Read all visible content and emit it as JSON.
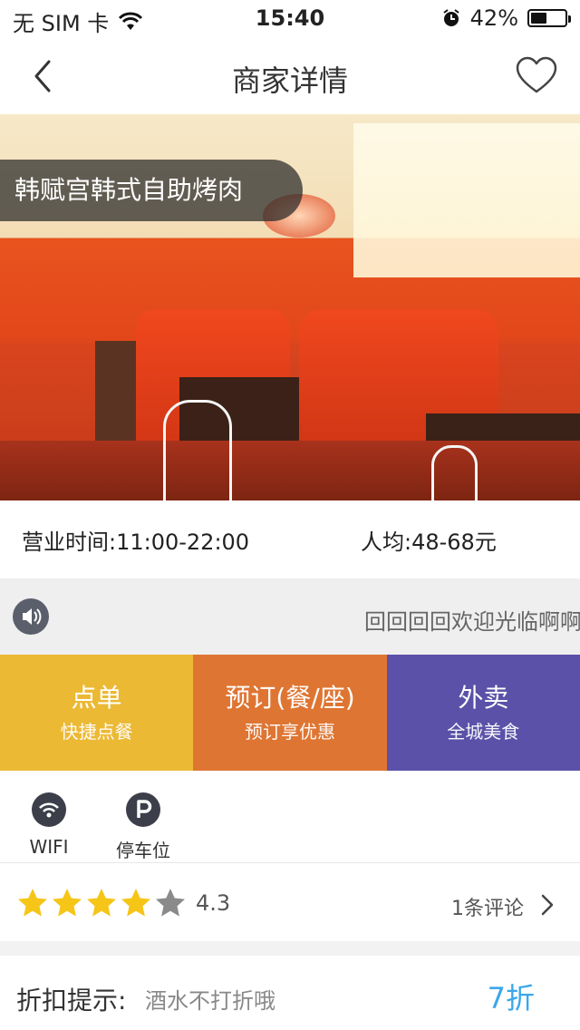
{
  "status_bar": {
    "carrier": "无 SIM 卡",
    "time": "15:40",
    "battery_percent": "42%",
    "battery_level": 0.42,
    "icons": [
      "wifi-icon",
      "alarm-icon",
      "battery-icon"
    ]
  },
  "nav": {
    "title": "商家详情",
    "back_icon": "chevron-left-icon",
    "favorite_icon": "heart-outline-icon"
  },
  "hero": {
    "restaurant_name": "韩赋宫韩式自助烤肉"
  },
  "info": {
    "hours": "营业时间:11:00-22:00",
    "avg_price": "人均:48-68元"
  },
  "notice": {
    "icon": "speaker-icon",
    "text": "回回回回欢迎光临啊啊啊"
  },
  "actions": [
    {
      "title": "点单",
      "subtitle": "快捷点餐",
      "color": "#ecb935"
    },
    {
      "title": "预订(餐/座)",
      "subtitle": "预订享优惠",
      "color": "#df7532"
    },
    {
      "title": "外卖",
      "subtitle": "全城美食",
      "color": "#5b51a8"
    }
  ],
  "amenities": [
    {
      "label": "WIFI",
      "icon": "wifi-icon"
    },
    {
      "label": "停车位",
      "icon": "parking-icon"
    }
  ],
  "rating": {
    "score": "4.3",
    "stars_filled": 4,
    "stars_total": 5,
    "reviews": "1条评论",
    "star_color": "#f5c518"
  },
  "discount": {
    "label": "折扣提示:",
    "text": "酒水不打折哦",
    "value": "7折",
    "value_color": "#3aa7ea"
  }
}
